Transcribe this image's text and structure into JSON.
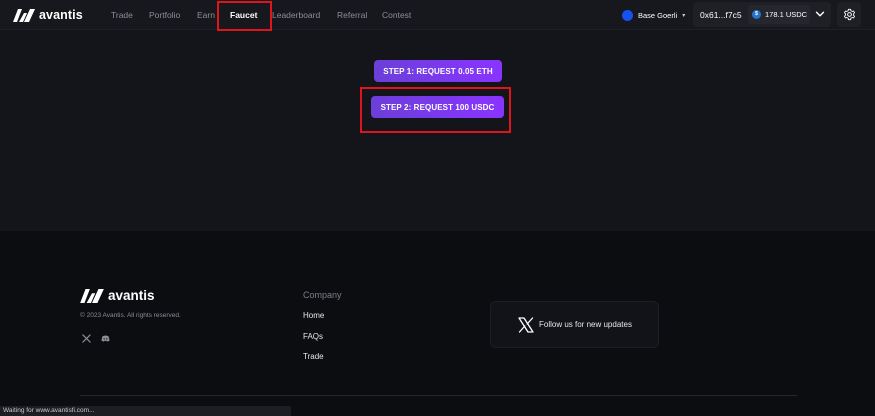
{
  "header": {
    "brand": "avantis",
    "nav": [
      "Trade",
      "Portfolio",
      "Earn",
      "Faucet",
      "Leaderboard",
      "Referral",
      "Contest"
    ],
    "active_nav": "Faucet",
    "network": {
      "label": "Base Goerli",
      "caret": "▾",
      "icon": "base-network-dot"
    },
    "wallet": {
      "address": "0x61...f7c5",
      "balance": "178.1 USDC",
      "token_icon": "usdc-icon"
    },
    "settings_icon": "gear-icon"
  },
  "main": {
    "step1_label": "STEP 1: REQUEST 0.05 ETH",
    "step2_label": "STEP 2: REQUEST 100 USDC"
  },
  "footer": {
    "brand": "avantis",
    "copyright": "© 2023 Avantis. All rights reserved.",
    "social": [
      "x-icon",
      "discord-icon"
    ],
    "company_heading": "Company",
    "links": [
      "Home",
      "FAQs",
      "Trade"
    ],
    "follow_text": "Follow us for new updates"
  },
  "status_bar": {
    "text": "Waiting for www.avantisfi.com..."
  },
  "colors": {
    "accent_start": "#6b3fd8",
    "accent_end": "#8a34ff",
    "annotation": "#e0151b",
    "background": "#14151a",
    "footer_bg": "#0c0d10"
  }
}
